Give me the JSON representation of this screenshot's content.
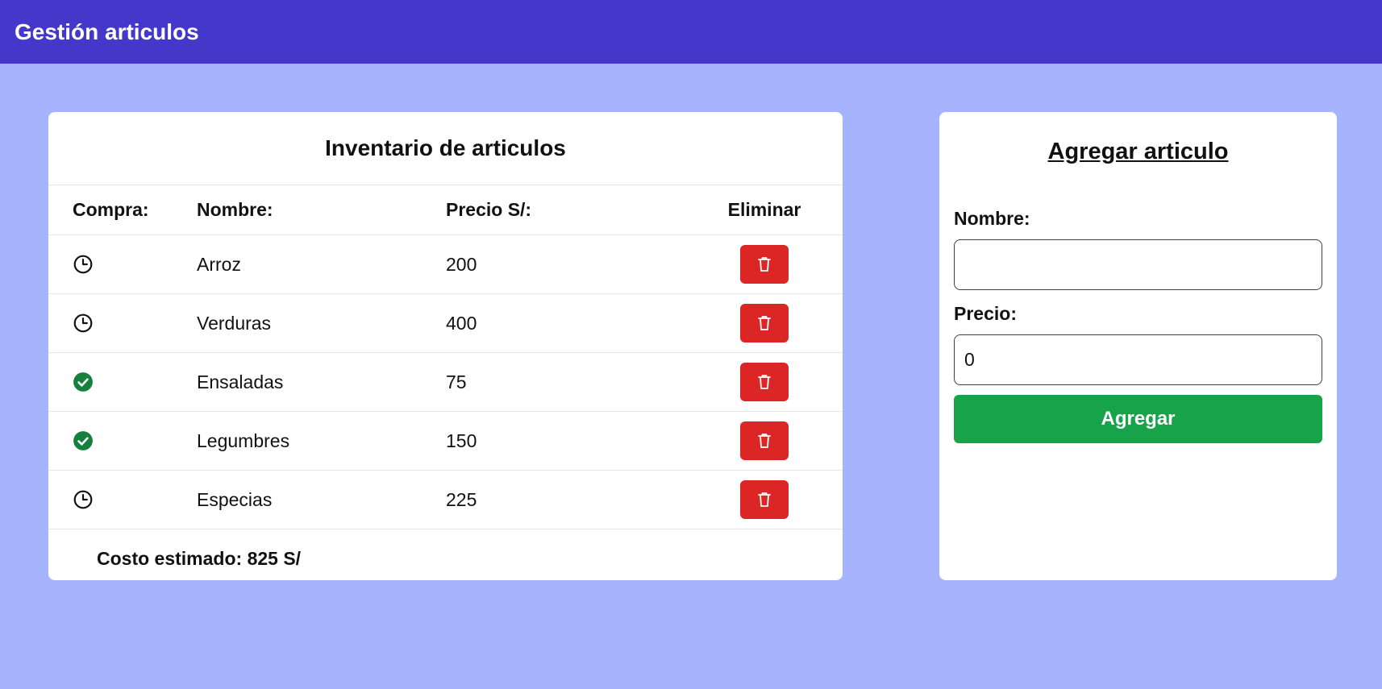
{
  "header": {
    "title": "Gestión articulos"
  },
  "inventory": {
    "title": "Inventario de articulos",
    "columns": {
      "compra": "Compra:",
      "nombre": "Nombre:",
      "precio": "Precio S/:",
      "eliminar": "Eliminar"
    },
    "items": [
      {
        "status": "pending",
        "status_icon": "clock-icon",
        "nombre": "Arroz",
        "precio": "200"
      },
      {
        "status": "pending",
        "status_icon": "clock-icon",
        "nombre": "Verduras",
        "precio": "400"
      },
      {
        "status": "purchased",
        "status_icon": "check-circle-icon",
        "nombre": "Ensaladas",
        "precio": "75"
      },
      {
        "status": "purchased",
        "status_icon": "check-circle-icon",
        "nombre": "Legumbres",
        "precio": "150"
      },
      {
        "status": "pending",
        "status_icon": "clock-icon",
        "nombre": "Especias",
        "precio": "225"
      }
    ],
    "delete_icon": "trash-icon",
    "total": "Costo estimado: 825 S/"
  },
  "add_form": {
    "title": "Agregar articulo",
    "nombre_label": "Nombre:",
    "nombre_value": "",
    "precio_label": "Precio:",
    "precio_value": "0",
    "submit_label": "Agregar"
  },
  "colors": {
    "page_background": "#a5b4fc",
    "header_background": "#4338ca",
    "delete_button": "#dc2626",
    "add_button": "#16a34a",
    "check_icon": "#15803d"
  }
}
